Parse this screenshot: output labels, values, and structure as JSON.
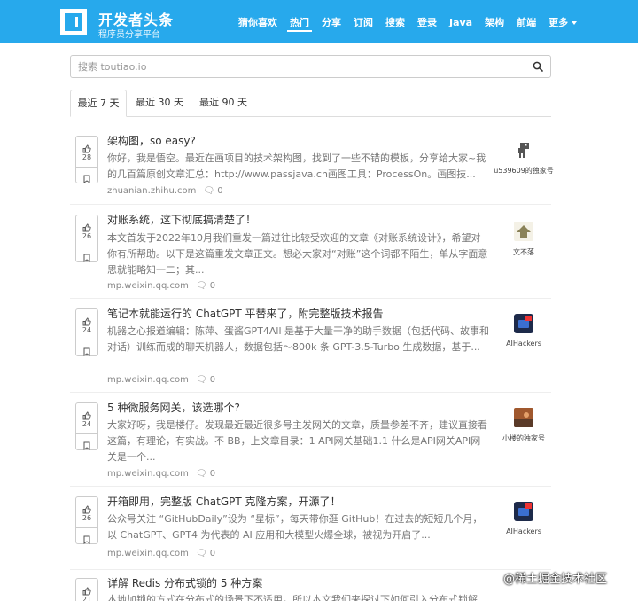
{
  "brand": {
    "name": "开发者头条",
    "subtitle": "程序员分享平台"
  },
  "nav": [
    {
      "label": "猜你喜欢",
      "active": false
    },
    {
      "label": "热门",
      "active": true
    },
    {
      "label": "分享",
      "active": false
    },
    {
      "label": "订阅",
      "active": false
    },
    {
      "label": "搜索",
      "active": false
    },
    {
      "label": "登录",
      "active": false
    },
    {
      "label": "Java",
      "active": false
    },
    {
      "label": "架构",
      "active": false
    },
    {
      "label": "前端",
      "active": false
    },
    {
      "label": "更多",
      "active": false
    }
  ],
  "search": {
    "placeholder": "搜索 toutiao.io",
    "value": "",
    "icon": "search-icon"
  },
  "tabs": [
    {
      "label": "最近 7 天",
      "active": true
    },
    {
      "label": "最近 30 天",
      "active": false
    },
    {
      "label": "最近 90 天",
      "active": false
    }
  ],
  "articles": [
    {
      "votes": "28",
      "title": "架构图，so easy?",
      "summary": "你好，我是悟空。最近在画项目的技术架构图，找到了一些不错的模板，分享给大家~我的几百篇原创文章汇总：http://www.passjava.cn画图工具：ProcessOn。画图技...",
      "source": "zhuanian.zhihu.com",
      "comments": "0",
      "author": "u539609的独家号"
    },
    {
      "votes": "26",
      "title": "对账系统，这下彻底搞清楚了！",
      "summary": "本文首发于2022年10月我们重发一篇过往比较受欢迎的文章《对账系统设计》，希望对你有所帮助。以下是这篇重发文章正文。想必大家对“对账”这个词都不陌生，单从字面意思就能略知一二；其...",
      "source": "mp.weixin.qq.com",
      "comments": "0",
      "author": "文不落"
    },
    {
      "votes": "24",
      "title": "笔记本就能运行的 ChatGPT 平替来了，附完整版技术报告",
      "summary": "机器之心报道编辑：陈萍、蛋酱GPT4All 是基于大量干净的助手数据（包括代码、故事和对话）训练而成的聊天机器人，数据包括～800k 条 GPT-3.5-Turbo 生成数据，基于...",
      "source": "mp.weixin.qq.com",
      "comments": "0",
      "author": "AIHackers"
    },
    {
      "votes": "24",
      "title": "5 种微服务网关，该选哪个?",
      "summary": "大家好呀，我是楼仔。发现最近最近很多号主发网关的文章，质量参差不齐，建议直接看这篇，有理论，有实战。不 BB，上文章目录：1 API网关基础1.1 什么是API网关API网关是一个...",
      "source": "mp.weixin.qq.com",
      "comments": "0",
      "author": "小楼的独家号"
    },
    {
      "votes": "26",
      "title": "开箱即用，完整版 ChatGPT 克隆方案，开源了！",
      "summary": "公众号关注 “GitHubDaily”设为 “星标”，每天带你逛 GitHub！在过去的短短几个月，以 ChatGPT、GPT4 为代表的 AI 应用和大模型火爆全球，被视为开启了...",
      "source": "mp.weixin.qq.com",
      "comments": "0",
      "author": "AIHackers"
    },
    {
      "votes": "21",
      "title": "详解 Redis 分布式锁的 5 种方案",
      "summary": "本地加锁的方式在分布式的场景下不适用，所以本文我们来探讨下如何引入分布式锁解决...",
      "source": "",
      "comments": "",
      "author": ""
    }
  ],
  "watermark": "@稀土掘金技术社区",
  "colors": {
    "brand_blue": "#27a9ec",
    "title_text": "#333333",
    "summary_text": "#777777"
  }
}
